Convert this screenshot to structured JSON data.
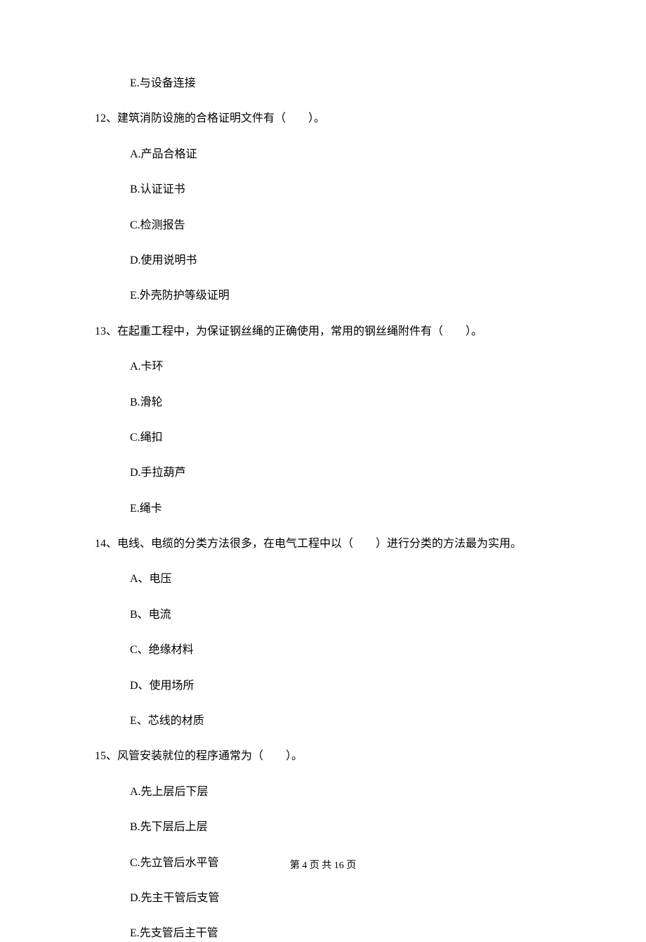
{
  "q11_trailing_options": [
    "E.与设备连接"
  ],
  "q12": {
    "stem": "12、建筑消防设施的合格证明文件有（　　）。",
    "options": [
      "A.产品合格证",
      "B.认证证书",
      "C.检测报告",
      "D.使用说明书",
      "E.外壳防护等级证明"
    ]
  },
  "q13": {
    "stem": "13、在起重工程中，为保证钢丝绳的正确使用，常用的钢丝绳附件有（　　）。",
    "options": [
      "A.卡环",
      "B.滑轮",
      "C.绳扣",
      "D.手拉葫芦",
      "E.绳卡"
    ]
  },
  "q14": {
    "stem": "14、电线、电缆的分类方法很多，在电气工程中以（　　）进行分类的方法最为实用。",
    "options": [
      "A、电压",
      "B、电流",
      "C、绝缘材料",
      "D、使用场所",
      "E、芯线的材质"
    ]
  },
  "q15": {
    "stem": "15、风管安装就位的程序通常为（　　）。",
    "options": [
      "A.先上层后下层",
      "B.先下层后上层",
      "C.先立管后水平管",
      "D.先主干管后支管",
      "E.先支管后主干管"
    ]
  },
  "footer": "第 4 页 共 16 页"
}
